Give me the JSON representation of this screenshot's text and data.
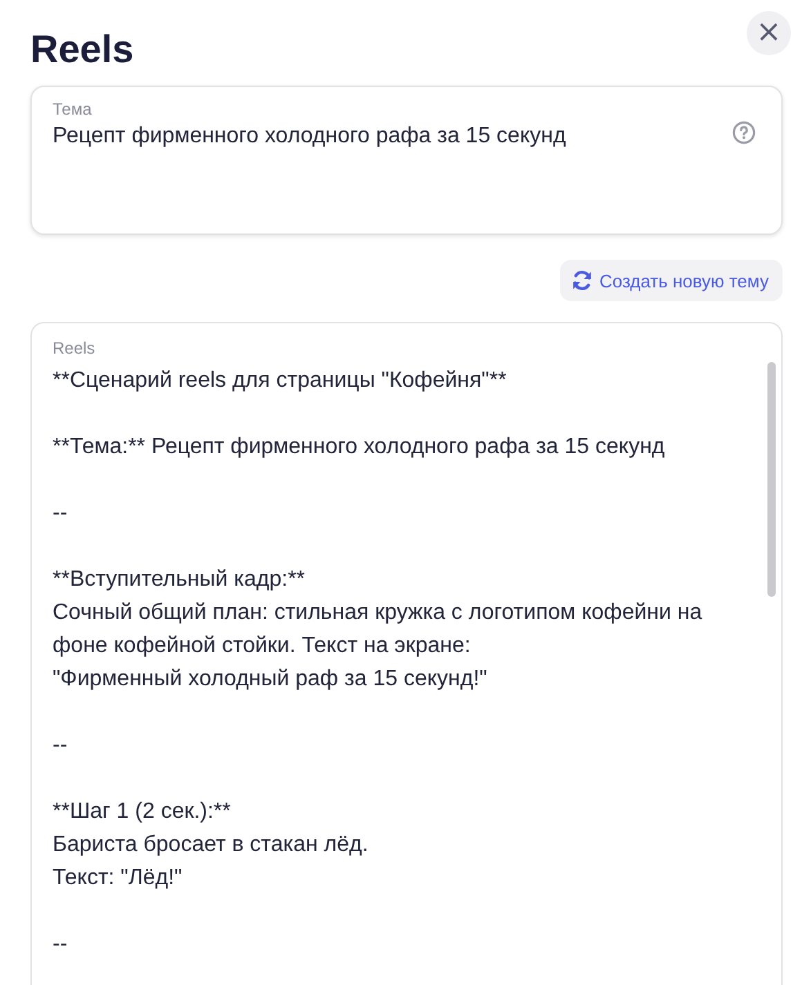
{
  "title": "Reels",
  "close": {
    "label": "×"
  },
  "topic": {
    "label": "Тема",
    "value": "Рецепт фирменного холодного рафа за 15 секунд"
  },
  "new_topic_button": {
    "label": "Создать новую тему"
  },
  "reels": {
    "label": "Reels",
    "value": "**Сценарий reels для страницы \"Кофейня\"**\n\n**Тема:** Рецепт фирменного холодного рафа за 15 секунд\n\n--\n\n**Вступительный кадр:**\nСочный общий план: стильная кружка с логотипом кофейни на фоне кофейной стойки. Текст на экране:\n\"Фирменный холодный раф за 15 секунд!\"\n\n--\n\n**Шаг 1 (2 сек.):**\nБариста бросает в стакан лёд.\nТекст: \"Лёд!\"\n\n--"
  }
}
